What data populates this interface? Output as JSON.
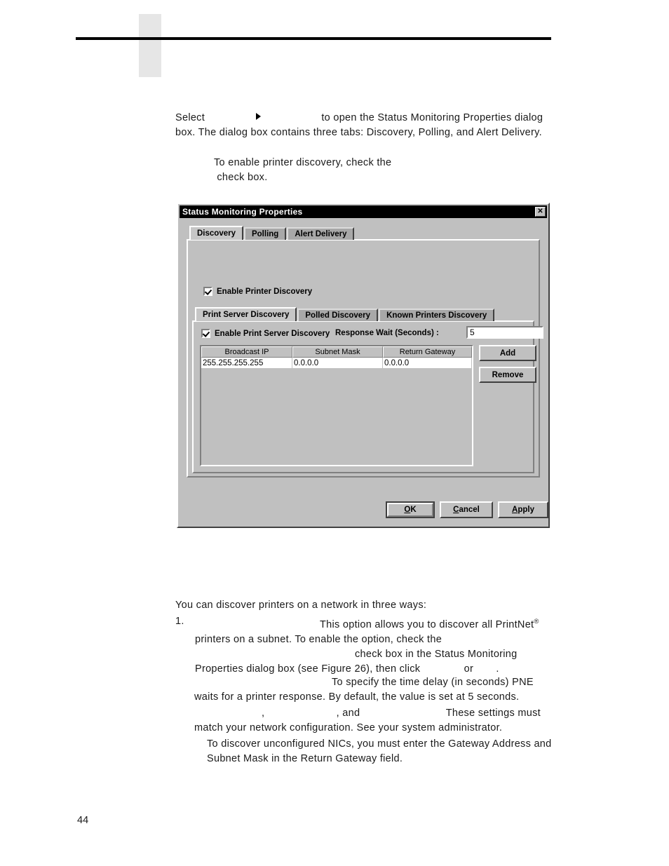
{
  "page": {
    "number": "44"
  },
  "intro": {
    "before_menu": "Select",
    "menu_separator_icon": "right-triangle-icon",
    "after_menu": "to open the Status Monitoring Properties dialog box. The dialog box contains three tabs: Discovery, Polling, and Alert Delivery."
  },
  "note_enable": {
    "line1": "To enable printer discovery, check the",
    "line2": "check box."
  },
  "dialog": {
    "title": "Status Monitoring Properties",
    "close_label": "✕",
    "outer_tabs": [
      {
        "label": "Discovery",
        "active": true
      },
      {
        "label": "Polling",
        "active": false
      },
      {
        "label": "Alert Delivery",
        "active": false
      }
    ],
    "enable_printer_discovery": {
      "label": "Enable Printer Discovery",
      "checked": true
    },
    "inner_tabs": [
      {
        "label": "Print Server Discovery",
        "active": true
      },
      {
        "label": "Polled Discovery",
        "active": false
      },
      {
        "label": "Known Printers Discovery",
        "active": false
      }
    ],
    "enable_print_server_discovery": {
      "label": "Enable Print Server Discovery",
      "checked": true
    },
    "response_wait": {
      "label": "Response Wait (Seconds) :",
      "value": "5"
    },
    "listview": {
      "columns": [
        "Broadcast IP",
        "Subnet Mask",
        "Return Gateway"
      ],
      "rows": [
        [
          "255.255.255.255",
          "0.0.0.0",
          "0.0.0.0"
        ]
      ]
    },
    "side_buttons": {
      "add": "Add",
      "remove": "Remove"
    },
    "footer_buttons": {
      "ok": "OK",
      "ok_accel": "O",
      "cancel": "Cancel",
      "cancel_accel": "C",
      "apply": "Apply",
      "apply_accel": "A"
    }
  },
  "ways": {
    "heading": "You can discover printers on a network in three ways:"
  },
  "item1": {
    "number": "1.",
    "seg1": "This option allows you to discover all PrintNet",
    "registered_mark": "®",
    "seg2": "printers on a subnet. To enable the option, check the",
    "seg3": "check box in the Status Monitoring Properties dialog box (see Figure 26), then click",
    "seg4": "or",
    "seg5": "."
  },
  "response_para": {
    "text": "To specify the time delay (in seconds) PNE waits for a printer response. By default, the value is set at 5 seconds."
  },
  "settings_para": {
    "comma1": ",",
    "comma2": ", and",
    "text": "These settings must match your network configuration. See your system administrator."
  },
  "note_nics": {
    "text": "To discover unconfigured NICs, you must enter the Gateway Address and Subnet Mask in the Return Gateway field."
  }
}
